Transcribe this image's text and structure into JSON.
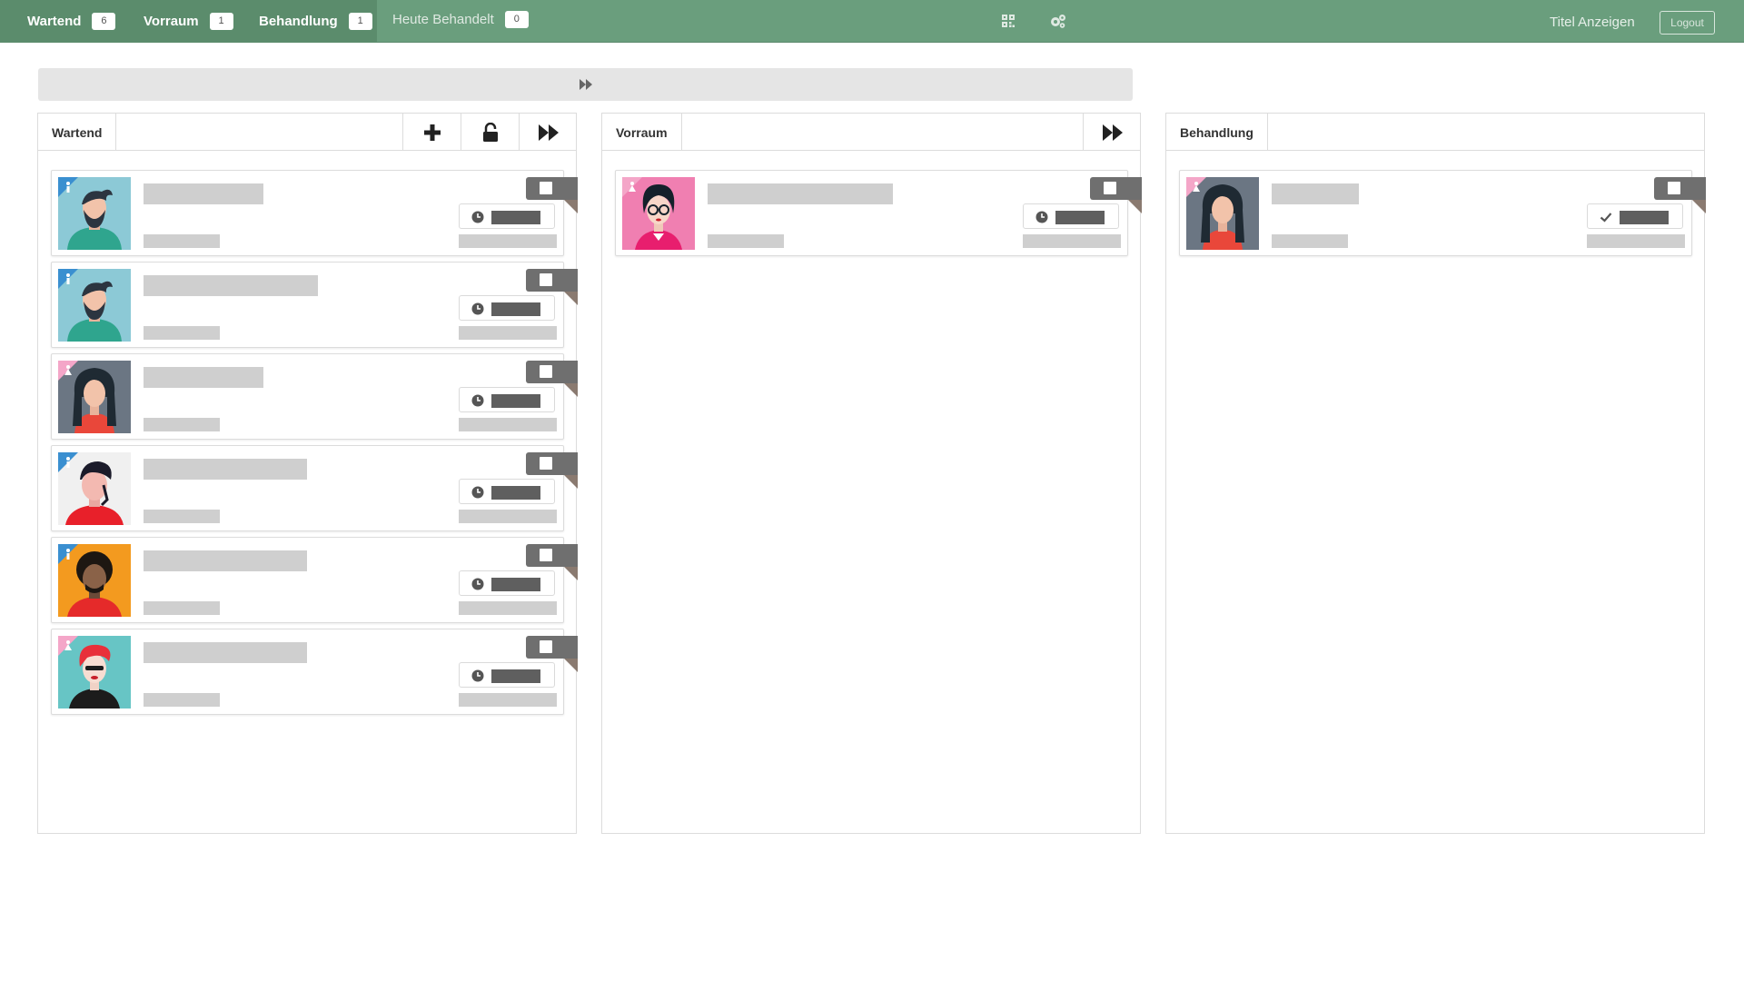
{
  "topbar": {
    "tabs": [
      {
        "label": "Wartend",
        "count": "6"
      },
      {
        "label": "Vorraum",
        "count": "1"
      },
      {
        "label": "Behandlung",
        "count": "1"
      },
      {
        "label": "Heute Behandelt",
        "count": "0"
      }
    ],
    "icons": [
      "qrcode-icon",
      "gears-icon"
    ],
    "titel_anzeigen": "Titel Anzeigen",
    "logout": "Logout"
  },
  "columns": [
    {
      "title": "Wartend",
      "buttons": [
        "plus-icon",
        "unlock-icon",
        "forward-icon"
      ],
      "patient_count": 6
    },
    {
      "title": "Vorraum",
      "buttons": [
        "forward-icon"
      ],
      "patient_count": 1
    },
    {
      "title": "Behandlung",
      "buttons": [],
      "patient_count": 1
    }
  ],
  "colors": {
    "topbar": "#6a9e7d",
    "topbar_active": "#5b8c6c",
    "gender_male": "#3a8fd0",
    "gender_female": "#f4a6c8",
    "flag": "#6f6f6f"
  }
}
